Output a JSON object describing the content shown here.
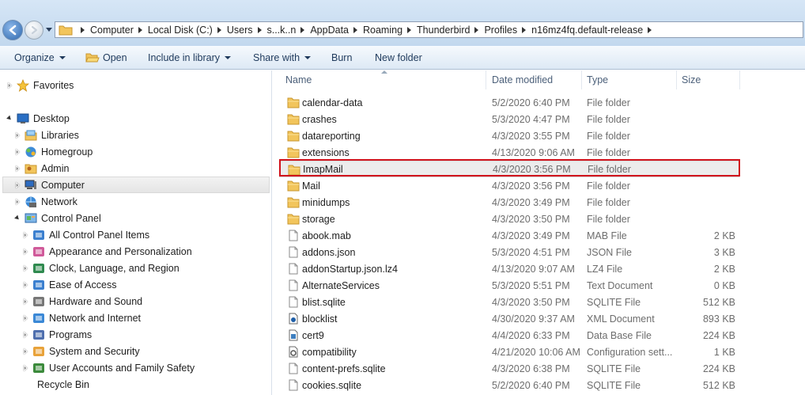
{
  "address": {
    "crumbs": [
      "Computer",
      "Local Disk (C:)",
      "Users",
      "s...k..n",
      "AppData",
      "Roaming",
      "Thunderbird",
      "Profiles",
      "n16mz4fq.default-release"
    ]
  },
  "toolbar": {
    "organize": "Organize",
    "open": "Open",
    "include_in_library": "Include in library",
    "share_with": "Share with",
    "burn": "Burn",
    "new_folder": "New folder"
  },
  "nav": {
    "favorites": "Favorites",
    "desktop": "Desktop",
    "libraries": "Libraries",
    "homegroup": "Homegroup",
    "admin": "Admin",
    "computer": "Computer",
    "network": "Network",
    "control_panel": "Control Panel",
    "cp_items": [
      "All Control Panel Items",
      "Appearance and Personalization",
      "Clock, Language, and Region",
      "Ease of Access",
      "Hardware and Sound",
      "Network and Internet",
      "Programs",
      "System and Security",
      "User Accounts and Family Safety"
    ],
    "recycle_bin": "Recycle Bin"
  },
  "columns": {
    "name": "Name",
    "date": "Date modified",
    "type": "Type",
    "size": "Size"
  },
  "files": [
    {
      "name": "calendar-data",
      "date": "5/2/2020 6:40 PM",
      "type": "File folder",
      "size": "",
      "kind": "folder"
    },
    {
      "name": "crashes",
      "date": "5/3/2020 4:47 PM",
      "type": "File folder",
      "size": "",
      "kind": "folder"
    },
    {
      "name": "datareporting",
      "date": "4/3/2020 3:55 PM",
      "type": "File folder",
      "size": "",
      "kind": "folder"
    },
    {
      "name": "extensions",
      "date": "4/13/2020 9:06 AM",
      "type": "File folder",
      "size": "",
      "kind": "folder"
    },
    {
      "name": "ImapMail",
      "date": "4/3/2020 3:56 PM",
      "type": "File folder",
      "size": "",
      "kind": "folder"
    },
    {
      "name": "Mail",
      "date": "4/3/2020 3:56 PM",
      "type": "File folder",
      "size": "",
      "kind": "folder"
    },
    {
      "name": "minidumps",
      "date": "4/3/2020 3:49 PM",
      "type": "File folder",
      "size": "",
      "kind": "folder"
    },
    {
      "name": "storage",
      "date": "4/3/2020 3:50 PM",
      "type": "File folder",
      "size": "",
      "kind": "folder"
    },
    {
      "name": "abook.mab",
      "date": "4/3/2020 3:49 PM",
      "type": "MAB File",
      "size": "2 KB",
      "kind": "file"
    },
    {
      "name": "addons.json",
      "date": "5/3/2020 4:51 PM",
      "type": "JSON File",
      "size": "3 KB",
      "kind": "file"
    },
    {
      "name": "addonStartup.json.lz4",
      "date": "4/13/2020 9:07 AM",
      "type": "LZ4 File",
      "size": "2 KB",
      "kind": "file"
    },
    {
      "name": "AlternateServices",
      "date": "5/3/2020 5:51 PM",
      "type": "Text Document",
      "size": "0 KB",
      "kind": "file"
    },
    {
      "name": "blist.sqlite",
      "date": "4/3/2020 3:50 PM",
      "type": "SQLITE File",
      "size": "512 KB",
      "kind": "file"
    },
    {
      "name": "blocklist",
      "date": "4/30/2020 9:37 AM",
      "type": "XML Document",
      "size": "893 KB",
      "kind": "xml"
    },
    {
      "name": "cert9",
      "date": "4/4/2020 6:33 PM",
      "type": "Data Base File",
      "size": "224 KB",
      "kind": "db"
    },
    {
      "name": "compatibility",
      "date": "4/21/2020 10:06 AM",
      "type": "Configuration sett...",
      "size": "1 KB",
      "kind": "config"
    },
    {
      "name": "content-prefs.sqlite",
      "date": "4/3/2020 6:38 PM",
      "type": "SQLITE File",
      "size": "224 KB",
      "kind": "file"
    },
    {
      "name": "cookies.sqlite",
      "date": "5/2/2020 6:40 PM",
      "type": "SQLITE File",
      "size": "512 KB",
      "kind": "file"
    }
  ],
  "highlighted_file": "ImapMail",
  "colors": {
    "highlight_box": "#d0121b",
    "folder": "#f2c55c"
  }
}
